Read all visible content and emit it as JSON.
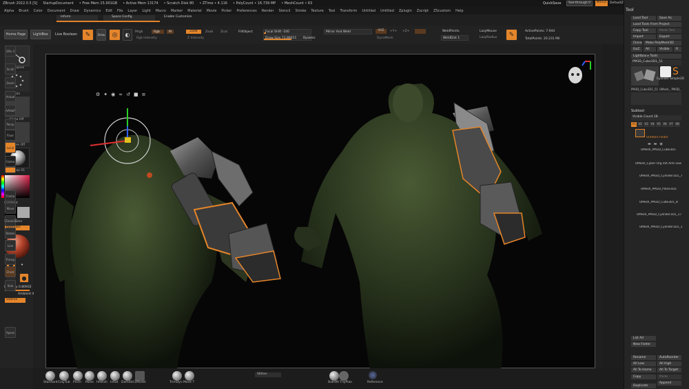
{
  "titlebar": {
    "app": "ZBrush 2022.0.5 [S]",
    "doc": "StartupDocument",
    "stats": [
      "• Free Mem 15.901GB",
      "• Active Mem 13174",
      "• Scratch Disk 80",
      "• ZTime • 4.116",
      "• PolyCount • 16.739 MP",
      "• MeshCount • 63"
    ],
    "quicksave": "QuickSave",
    "seethrough": "See-through",
    "seethrough_val": "0",
    "menus_btn": "Menus",
    "script": "DefaultZScript"
  },
  "menu": [
    "Alpha",
    "Brush",
    "Color",
    "Document",
    "Draw",
    "Dynamics",
    "Edit",
    "File",
    "Layer",
    "Light",
    "Macro",
    "Marker",
    "Material",
    "Movie",
    "Picker",
    "Preferences",
    "Render",
    "Stencil",
    "Stroke",
    "Texture",
    "Tool",
    "Transform",
    "Untitled",
    "Untitled",
    "Zplugin",
    "Zscript",
    "ZScustom",
    "Help"
  ],
  "subbar": {
    "inform": "Inform",
    "space_config": "Space Config",
    "enable_customize": "Enable Customize"
  },
  "toolbar": {
    "home": "Home Page",
    "lightbox": "LightBox",
    "live_boolean": "Live Boolean",
    "edit": "Edit",
    "draw": "Draw",
    "move": "Move",
    "scale": "Scale",
    "rotate": "Rotate",
    "mrgb": "Mrgb",
    "rgb": "Rgb",
    "m": "M",
    "rgb_intensity": "Rgb Intensity",
    "zadd": "Zadd",
    "zsub": "Zsub",
    "zcut": "Zcut",
    "z_intensity": "Z Intensity",
    "fill_object": "FillObject",
    "focal_shift": "Focal Shift -100",
    "draw_size": "Draw Size",
    "draw_size_val": "73.88011",
    "dynamic": "Dynamic",
    "mirror_weld": "Mirror And Weld",
    "xyz": "XYZ",
    "xplus": "+Y+",
    "zplus": "+Z+",
    "dynamesh": "DynaMesh",
    "weldpoints": "WeldPoints",
    "weld_dist": "WeldDist 1",
    "lazymouse": "LazyMouse",
    "lazy_radius": "LazyRadius",
    "active_points": "ActivePoints: 7.944",
    "total_points": "TotalPoints: 20.231 Mil"
  },
  "leftshelf": {
    "transpose": "Transpose",
    "dots": "Dots",
    "alpha": "Alpha Off",
    "texture": "Texture Off",
    "material": "MatCap 01",
    "gradient": "Gradient",
    "switch_color": "SwitchColor",
    "alternate": "Alternate",
    "intensity": "Intensity 0.80932",
    "ambient": "Ambient 4",
    "outline": "Outline"
  },
  "rightshelf": [
    "SPix 3",
    "Scroll",
    "Zoom",
    "Actual",
    "AAHalf",
    "Persp",
    "Floor",
    "Local",
    "Gizmo",
    "Frame",
    "Move",
    "Zoom3D",
    "Rotate",
    "Line Fill PolyF",
    "Transp",
    "Ghost",
    "Solo",
    "Xpose"
  ],
  "bottombar": {
    "brushes": [
      "Standard",
      "ClayTub",
      "Pinch",
      "Move",
      "hPolish",
      "Inflat",
      "DamStd",
      "ZModel",
      "TrimDyn",
      "Move T"
    ],
    "search": "Slither",
    "ballsmi": "BallsMi TnyPlan",
    "reference": "Reference"
  },
  "panel": {
    "title": "Tool",
    "load_tool": "Load Tool",
    "save_as": "Save As",
    "load_from_project": "Load Tools From Project",
    "copy_tool": "Copy Tool",
    "paste_tool": "Paste Tool",
    "import": "Import",
    "export": "Export",
    "clone": "Clone",
    "make_polymesh": "Make PolyMesh3D",
    "goz": "GoZ",
    "all": "All",
    "visible": "Visible",
    "r": "R",
    "lightbox_tools": "Lightbox ▸ Tools",
    "current_tool": "PM3D_Cube3D1_51",
    "cylinder": "Cylinder Simple3D",
    "thumb_labels": [
      "PM3D_Cube3D1_51",
      "UMesh_",
      "PM3D_"
    ],
    "subtool": "Subtool",
    "visible_count": "Visible Count 18",
    "tabs": [
      "V1",
      "V2",
      "V3",
      "V4",
      "V5",
      "V6",
      "V7",
      "V8"
    ],
    "subtools": [
      "Untitled Folder",
      "UMesh_PM3D_Cube3D1",
      "UMesh_Cyber Org mit Arm usw",
      "UMesh_PM3D_Cylinder3D1_7",
      "UMesh_PM3D_Plane3D3",
      "UMesh_PM3D_Cube3D1_8",
      "UMesh_PM3D_Cylinder3D1_17",
      "UMesh_PM3D_Cylinder3D1_1"
    ],
    "list_all": "List All",
    "new_folder": "New Folder",
    "rename": "Rename",
    "auto_reorder": "AutoReorder",
    "all_low": "All Low",
    "all_high": "All High",
    "all_to_home": "All To Home",
    "all_to_target": "All To Target",
    "copy": "Copy",
    "paste": "Paste",
    "duplicate": "Duplicate",
    "append": "Append"
  },
  "colors": {
    "accent": "#e5852a",
    "background": "#1f1f1f",
    "viewport": "#060606",
    "model": "#2f3a22"
  }
}
